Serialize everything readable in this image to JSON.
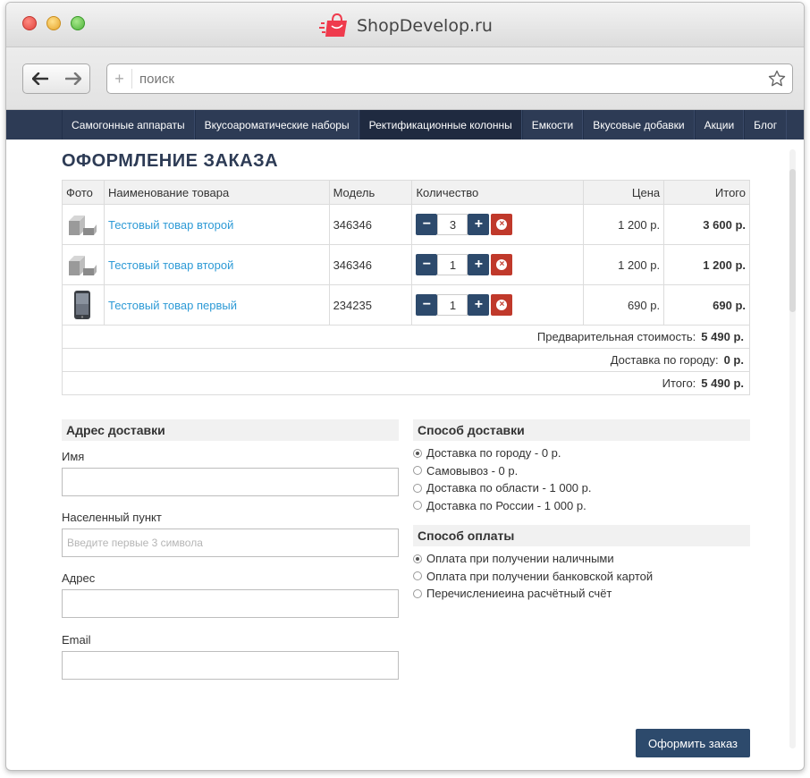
{
  "window": {
    "brand": "ShopDevelop.ru"
  },
  "toolbar": {
    "search_placeholder": "поиск"
  },
  "menu": [
    {
      "label": "Самогонные аппараты"
    },
    {
      "label": "Вкусоароматические наборы"
    },
    {
      "label": "Ректификационные колонны"
    },
    {
      "label": "Емкости"
    },
    {
      "label": "Вкусовые добавки"
    },
    {
      "label": "Акции"
    },
    {
      "label": "Блог"
    }
  ],
  "page": {
    "title": "ОФОРМЛЕНИЕ ЗАКАЗА"
  },
  "cart": {
    "headers": {
      "photo": "Фото",
      "name": "Наименование товара",
      "model": "Модель",
      "qty": "Количество",
      "price": "Цена",
      "total": "Итого"
    },
    "rows": [
      {
        "name": "Тестовый товар второй",
        "model": "346346",
        "qty": "3",
        "price": "1 200 р.",
        "total": "3 600 р.",
        "thumb": "box-icon"
      },
      {
        "name": "Тестовый товар второй",
        "model": "346346",
        "qty": "1",
        "price": "1 200 р.",
        "total": "1 200 р.",
        "thumb": "box-icon"
      },
      {
        "name": "Тестовый товар первый",
        "model": "234235",
        "qty": "1",
        "price": "690 р.",
        "total": "690 р.",
        "thumb": "phone-icon"
      }
    ],
    "summary": [
      {
        "label": "Предварительная стоимость:",
        "value": "5 490 р."
      },
      {
        "label": "Доставка по городу:",
        "value": "0 р."
      },
      {
        "label": "Итого:",
        "value": "5 490 р."
      }
    ]
  },
  "address": {
    "heading": "Адрес доставки",
    "name_label": "Имя",
    "name_value": "",
    "city_label": "Населенный пункт",
    "city_placeholder": "Введите первые 3 символа",
    "address_label": "Адрес",
    "address_value": "",
    "email_label": "Email",
    "email_value": ""
  },
  "delivery": {
    "heading": "Способ доставки",
    "options": [
      {
        "label": "Доставка по городу - 0 р.",
        "selected": true
      },
      {
        "label": "Самовывоз - 0 р.",
        "selected": false
      },
      {
        "label": "Доставка по области - 1 000 р.",
        "selected": false
      },
      {
        "label": "Доставка по России - 1 000 р.",
        "selected": false
      }
    ]
  },
  "payment": {
    "heading": "Способ оплаты",
    "options": [
      {
        "label": "Оплата при получении наличными",
        "selected": true
      },
      {
        "label": "Оплата при получении банковской картой",
        "selected": false
      },
      {
        "label": "Перечислениеина расчётный счёт",
        "selected": false
      }
    ]
  },
  "actions": {
    "submit_label": "Оформить заказ"
  },
  "colors": {
    "nav_bg": "#2d3b55",
    "accent_button": "#2d4a6c",
    "link": "#2d9ad6",
    "delete": "#c0392b"
  }
}
